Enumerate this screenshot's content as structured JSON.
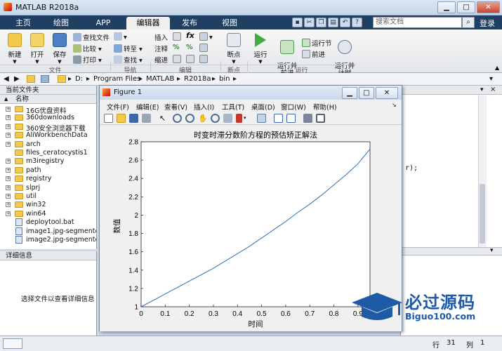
{
  "window": {
    "title": "MATLAB R2018a"
  },
  "ribbon": {
    "tabs": [
      "主页",
      "绘图",
      "APP",
      "编辑器",
      "发布",
      "视图"
    ],
    "search_placeholder": "搜索文档",
    "login_label": "登录",
    "editor_tools": {
      "new_label": "新建",
      "open_label": "打开",
      "save_label": "保存",
      "find_files_label": "查找文件",
      "compare_label": "比较",
      "print_label": "打印",
      "goto_label": "转至",
      "find_label": "查找",
      "insert_label": "插入",
      "comment_label": "注释",
      "indent_label": "缩进",
      "fx_label": "fx",
      "breakpoints_label": "断点",
      "run_label": "运行",
      "run_advance_label": "运行并\n前进",
      "run_section_label": "运行节",
      "advance_label": "前进",
      "run_time_label": "运行并\n计时"
    },
    "sections": [
      "文件",
      "导航",
      "编辑",
      "断点",
      "运行"
    ]
  },
  "address": {
    "segments": [
      "D:",
      "Program Files",
      "MATLAB",
      "R2018a",
      "bin"
    ]
  },
  "current_folder": {
    "title": "当前文件夹",
    "column": "名称",
    "items": [
      {
        "name": "16G优盘资料",
        "type": "folder",
        "expandable": true
      },
      {
        "name": "360downloads",
        "type": "folder",
        "expandable": true
      },
      {
        "name": "360安全浏览器下载",
        "type": "folder",
        "expandable": true
      },
      {
        "name": "AliWorkbenchData",
        "type": "folder",
        "expandable": true
      },
      {
        "name": "arch",
        "type": "folder",
        "expandable": true
      },
      {
        "name": "files_ceratocystis1",
        "type": "folder",
        "expandable": false
      },
      {
        "name": "m3iregistry",
        "type": "folder",
        "expandable": true
      },
      {
        "name": "path",
        "type": "folder",
        "expandable": true
      },
      {
        "name": "registry",
        "type": "folder",
        "expandable": true
      },
      {
        "name": "slprj",
        "type": "folder",
        "expandable": true
      },
      {
        "name": "util",
        "type": "folder",
        "expandable": true
      },
      {
        "name": "win32",
        "type": "folder",
        "expandable": true
      },
      {
        "name": "win64",
        "type": "folder",
        "expandable": true
      },
      {
        "name": "deploytool.bat",
        "type": "file",
        "expandable": false
      },
      {
        "name": "image1.jpg-segmente...",
        "type": "file",
        "expandable": false
      },
      {
        "name": "image2.jpg-segmente...",
        "type": "file",
        "expandable": false
      }
    ]
  },
  "details": {
    "title": "详细信息",
    "hint": "选择文件以查看详细信息"
  },
  "editor_snippet": "r);",
  "status": {
    "row_label": "行",
    "row_value": "31",
    "col_label": "列",
    "col_value": "1"
  },
  "figure": {
    "title": "Figure 1",
    "menu": [
      "文件(F)",
      "编辑(E)",
      "查看(V)",
      "插入(I)",
      "工具(T)",
      "桌面(D)",
      "窗口(W)",
      "帮助(H)"
    ]
  },
  "watermark": {
    "title": "必过源码",
    "url": "Biguo100.com"
  },
  "chart_data": {
    "type": "line",
    "title": "时变时滞分数阶方程的预估矫正解法",
    "xlabel": "时间",
    "ylabel": "数值",
    "xlim": [
      0,
      0.95
    ],
    "ylim": [
      1,
      2.8
    ],
    "xticks": [
      "0",
      "0.1",
      "0.2",
      "0.3",
      "0.4",
      "0.5",
      "0.6",
      "0.7",
      "0.8",
      "0.9"
    ],
    "yticks": [
      "1",
      "1.2",
      "1.4",
      "1.6",
      "1.8",
      "2",
      "2.2",
      "2.4",
      "2.6",
      "2.8"
    ],
    "series": [
      {
        "color": "#2f6fb6",
        "x": [
          0,
          0.05,
          0.1,
          0.15,
          0.2,
          0.25,
          0.3,
          0.35,
          0.4,
          0.45,
          0.5,
          0.55,
          0.6,
          0.65,
          0.7,
          0.75,
          0.8,
          0.85,
          0.9,
          0.95
        ],
        "y": [
          1.0,
          1.07,
          1.14,
          1.21,
          1.28,
          1.35,
          1.42,
          1.5,
          1.58,
          1.66,
          1.75,
          1.84,
          1.93,
          2.03,
          2.12,
          2.22,
          2.33,
          2.44,
          2.56,
          2.72
        ]
      }
    ],
    "grid": false
  }
}
